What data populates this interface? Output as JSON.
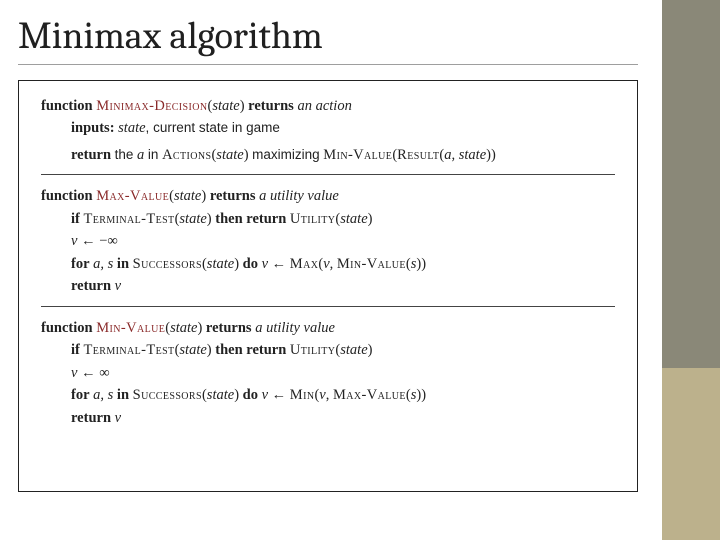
{
  "title": "Minimax algorithm",
  "kw": {
    "function": "function",
    "returns": "returns",
    "inputs": "inputs:",
    "return": "return",
    "if": "if",
    "then_return": "then return",
    "for": "for",
    "in": "in",
    "do": "do"
  },
  "fn": {
    "minimax_decision": "Minimax-Decision",
    "actions": "Actions",
    "min_value": "Min-Value",
    "max_value": "Max-Value",
    "result": "Result",
    "terminal_test": "Terminal-Test",
    "utility": "Utility",
    "successors": "Successors",
    "max": "Max",
    "min": "Min"
  },
  "txt": {
    "state": "state",
    "an_action": "an action",
    "current_state": "current state in game",
    "the": "the",
    "a": "a",
    "maximizing": "maximizing",
    "a_state": "a, state",
    "a_utility_value": "a utility value",
    "v": "v",
    "arrow": "←",
    "neg_inf": "−∞",
    "pos_inf": "∞",
    "a_s": "a, s",
    "s": "s",
    "comma_sp": ", "
  }
}
